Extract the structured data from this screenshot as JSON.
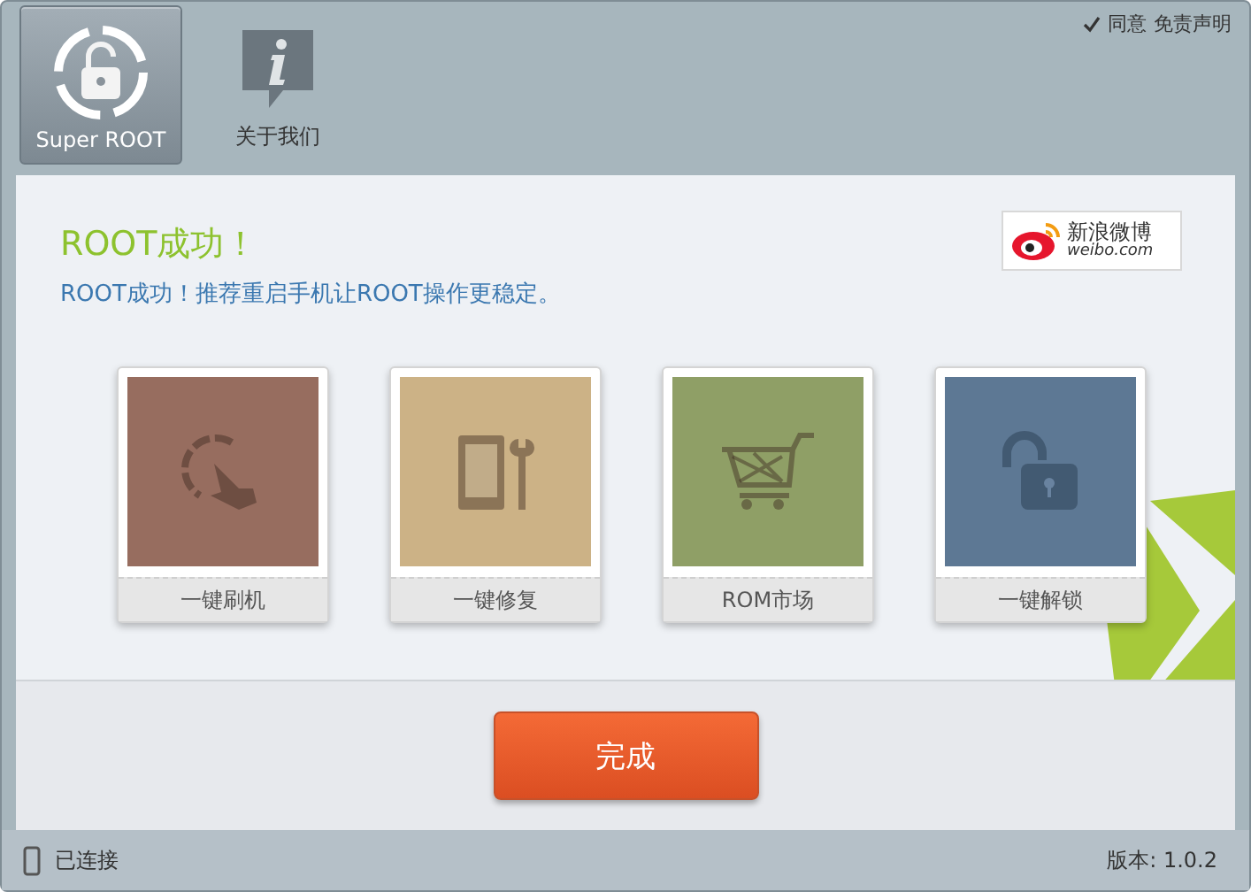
{
  "tabs": [
    {
      "label": "Super ROOT",
      "kind": "root",
      "selected": true
    },
    {
      "label": "关于我们",
      "kind": "about",
      "selected": false
    }
  ],
  "disclaimer": {
    "checked": true,
    "agree": "同意",
    "link": "免责声明"
  },
  "weibo": {
    "name": "新浪微博",
    "domain": "weibo.com"
  },
  "title": "ROOT成功！",
  "message": "ROOT成功！推荐重启手机让ROOT操作更稳定。",
  "tools": [
    {
      "label": "一键刷机",
      "kind": "flash",
      "color": "#976d5f"
    },
    {
      "label": "一键修复",
      "kind": "repair",
      "color": "#ccb286"
    },
    {
      "label": "ROM市场",
      "kind": "market",
      "color": "#8f9f66"
    },
    {
      "label": "一键解锁",
      "kind": "unlock",
      "color": "#5d7894"
    }
  ],
  "done_button": "完成",
  "status": {
    "connection": "已连接",
    "version": "版本: 1.0.2"
  }
}
